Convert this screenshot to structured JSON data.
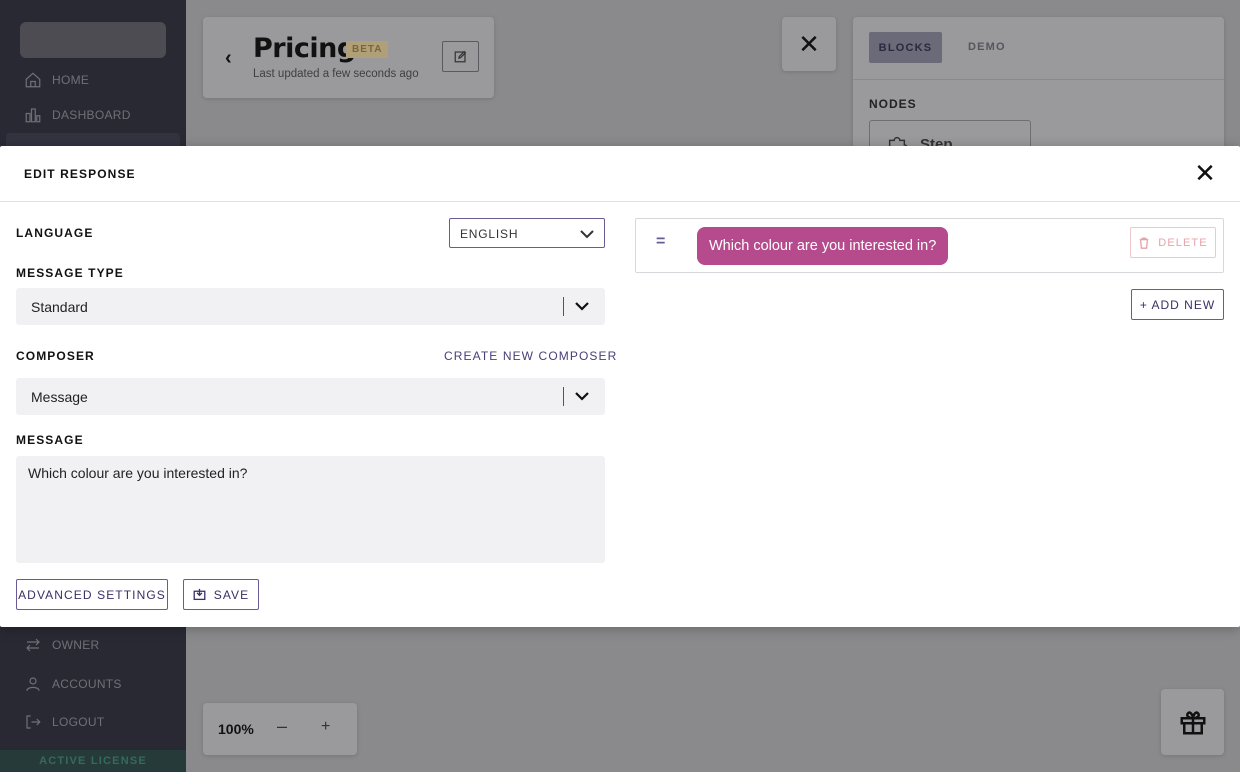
{
  "sidebar": {
    "items": [
      {
        "label": "HOME",
        "icon": "home-icon"
      },
      {
        "label": "DASHBOARD",
        "icon": "chart-icon"
      },
      {
        "label": "OWNER",
        "icon": "swap-icon"
      },
      {
        "label": "ACCOUNTS",
        "icon": "user-icon"
      },
      {
        "label": "LOGOUT",
        "icon": "logout-icon"
      }
    ],
    "license_label": "ACTIVE LICENSE"
  },
  "header": {
    "title": "Pricing",
    "badge": "BETA",
    "updated": "Last updated a few seconds ago"
  },
  "right_panel": {
    "tabs": [
      "BLOCKS",
      "DEMO"
    ],
    "nodes_label": "NODES",
    "step_label": "Step"
  },
  "zoom": {
    "value": "100%",
    "minus": "–",
    "plus": "+"
  },
  "modal": {
    "title": "EDIT RESPONSE",
    "language_label": "LANGUAGE",
    "language_value": "ENGLISH",
    "message_type_label": "MESSAGE TYPE",
    "message_type_value": "Standard",
    "composer_label": "COMPOSER",
    "create_composer": "CREATE NEW COMPOSER",
    "composer_value": "Message",
    "message_label": "MESSAGE",
    "message_value": "Which colour are you interested in?",
    "advanced_settings": "ADVANCED SETTINGS",
    "save": "SAVE",
    "preview_message": "Which colour are you interested in?",
    "delete": "DELETE",
    "add_new": "+ ADD NEW"
  },
  "colors": {
    "accent": "#6b5b95",
    "bubble": "#b54b8d",
    "delete": "#e7a3aa",
    "sidebar": "#1b1b2f"
  }
}
